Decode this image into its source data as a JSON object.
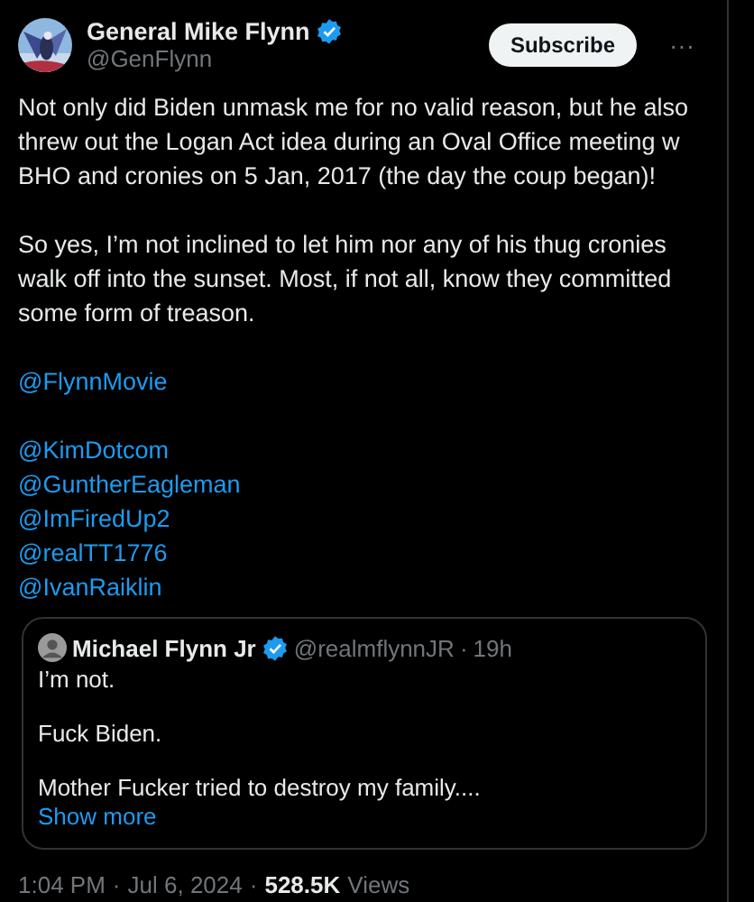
{
  "author": {
    "name": "General Mike Flynn",
    "handle": "@GenFlynn",
    "verified": true
  },
  "subscribe_button": "Subscribe",
  "more_button": "···",
  "paragraphs": [
    "Not only did Biden unmask me for no valid reason, but he also threw out the Logan Act idea during an Oval Office meeting w BHO and cronies on 5 Jan, 2017 (the day the coup began)!",
    "So yes, I’m not inclined to let him nor any of his thug cronies walk off into the sunset. Most, if not all, know they committed some form of treason."
  ],
  "mention_groups": [
    [
      "@FlynnMovie"
    ],
    [
      "@KimDotcom",
      "@GuntherEagleman",
      "@ImFiredUp2",
      "@realTT1776",
      "@IvanRaiklin"
    ]
  ],
  "quote": {
    "name": "Michael Flynn Jr",
    "verified": true,
    "handle": "@realmflynnJR",
    "separator": "·",
    "time": "19h",
    "paragraphs": [
      "I’m not.",
      "Fuck Biden.",
      "Mother Fucker tried to destroy my family...."
    ],
    "show_more": "Show more"
  },
  "footer": {
    "time": "1:04 PM",
    "separator": "·",
    "date": "Jul 6, 2024",
    "separator_2": "·",
    "views_count": "528.5K",
    "views_label": "Views"
  }
}
